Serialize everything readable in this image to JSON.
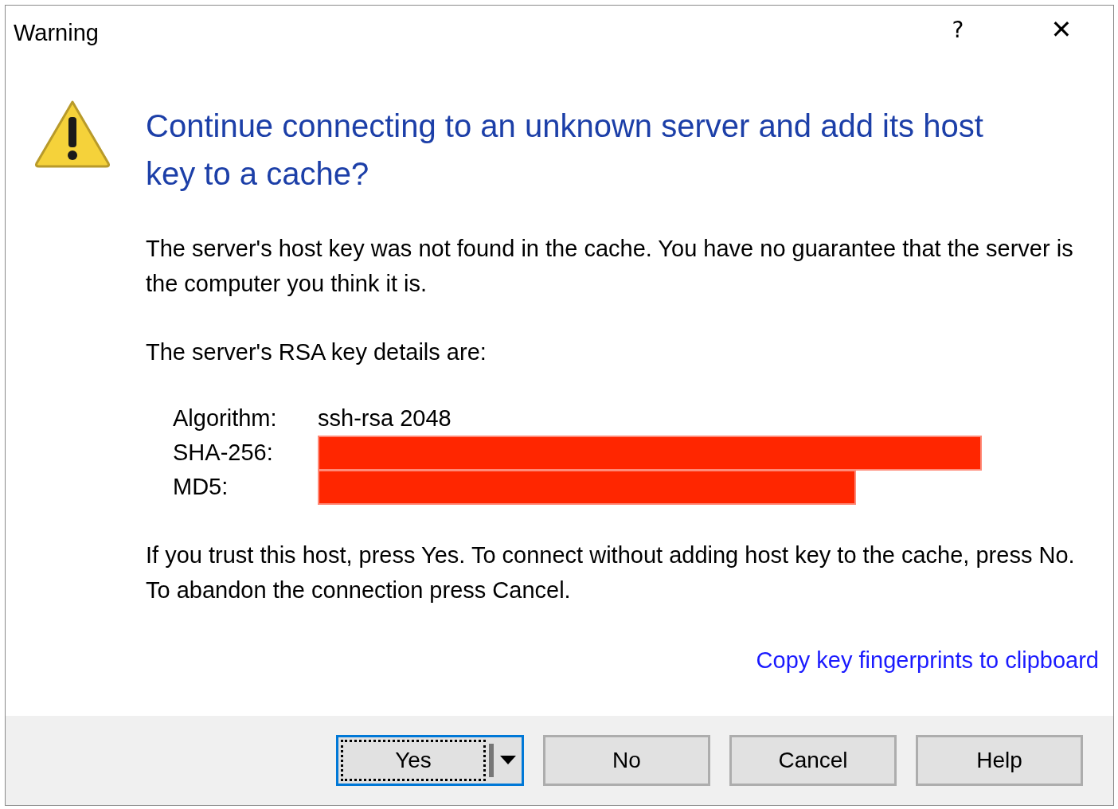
{
  "window": {
    "title": "Warning",
    "help_glyph": "?",
    "close_glyph": "✕"
  },
  "heading": "Continue connecting to an unknown server and add its host key to a cache?",
  "paragraphs": [
    "The server's host key was not found in the cache. You have no guarantee that the server is the computer you think it is.",
    "The server's RSA key details are:"
  ],
  "key_details": [
    {
      "label": "Algorithm:",
      "kind": "text",
      "value": "ssh-rsa 2048"
    },
    {
      "label": "SHA-256:",
      "kind": "redacted"
    },
    {
      "label": "MD5:",
      "kind": "redacted"
    }
  ],
  "instructions": "If you trust this host, press Yes. To connect without adding host key to the cache, press No. To abandon the connection press Cancel.",
  "link": "Copy key fingerprints to clipboard",
  "buttons": [
    {
      "label": "Yes",
      "default": true,
      "split": true
    },
    {
      "label": "No",
      "default": false,
      "split": false
    },
    {
      "label": "Cancel",
      "default": false,
      "split": false
    },
    {
      "label": "Help",
      "default": false,
      "split": false
    }
  ]
}
